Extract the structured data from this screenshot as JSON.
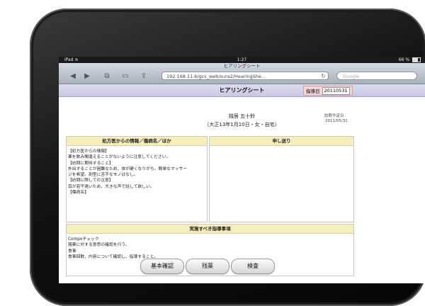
{
  "status_bar": {
    "carrier": "iPad",
    "time": "1:27",
    "battery": "66 %"
  },
  "browser": {
    "page_title": "ヒアリングシート",
    "url": "192.168.11.6/gcs_web/sura2/HearingShe...",
    "search_placeholder": "Google"
  },
  "sheet": {
    "title": "ヒアリングシート",
    "date_label": "指導日",
    "date_value": "20110531"
  },
  "patient": {
    "name": "独居 五十鈴",
    "info": "（大正13年1月10日・女・自宅）",
    "schedule_label": "訪問予定日",
    "schedule_date": "2011/05/31"
  },
  "panels": {
    "prescriber": {
      "title": "処方医からの情報／傷病名／ほか",
      "body": "【処方医からの情報】\n薬を飲み間違えることがないように注意してください。\n【訪問に期待すること】\n外出することが困難なため、体が硬くなりがち。簡単なマッサー\nジを希望。剤型に苦手なモノはなし。\n【訪問に際しての注意】\n耳が若干遠いため、大きな声で話して欲しい。\n【傷病名】"
    },
    "handover": {
      "title": "申し送り",
      "body": ""
    },
    "guidance": {
      "title": "実施すべき指導事項",
      "body": "Compoチェック\n服薬に対する意思の確認を行う。\n食事\n食事回数、内容について確認し、指導すること。"
    }
  },
  "buttons": {
    "basic_check": "基本確認",
    "leftover": "残薬",
    "test": "検査"
  },
  "colors": {
    "header_band": "#c8c8e4",
    "panel_header": "#f6efbc",
    "date_box": "#f4d6d6"
  },
  "icons": [
    "wifi-icon",
    "back-arrow-icon",
    "forward-arrow-icon",
    "tabs-icon",
    "bookmarks-icon",
    "share-icon",
    "reload-icon"
  ]
}
